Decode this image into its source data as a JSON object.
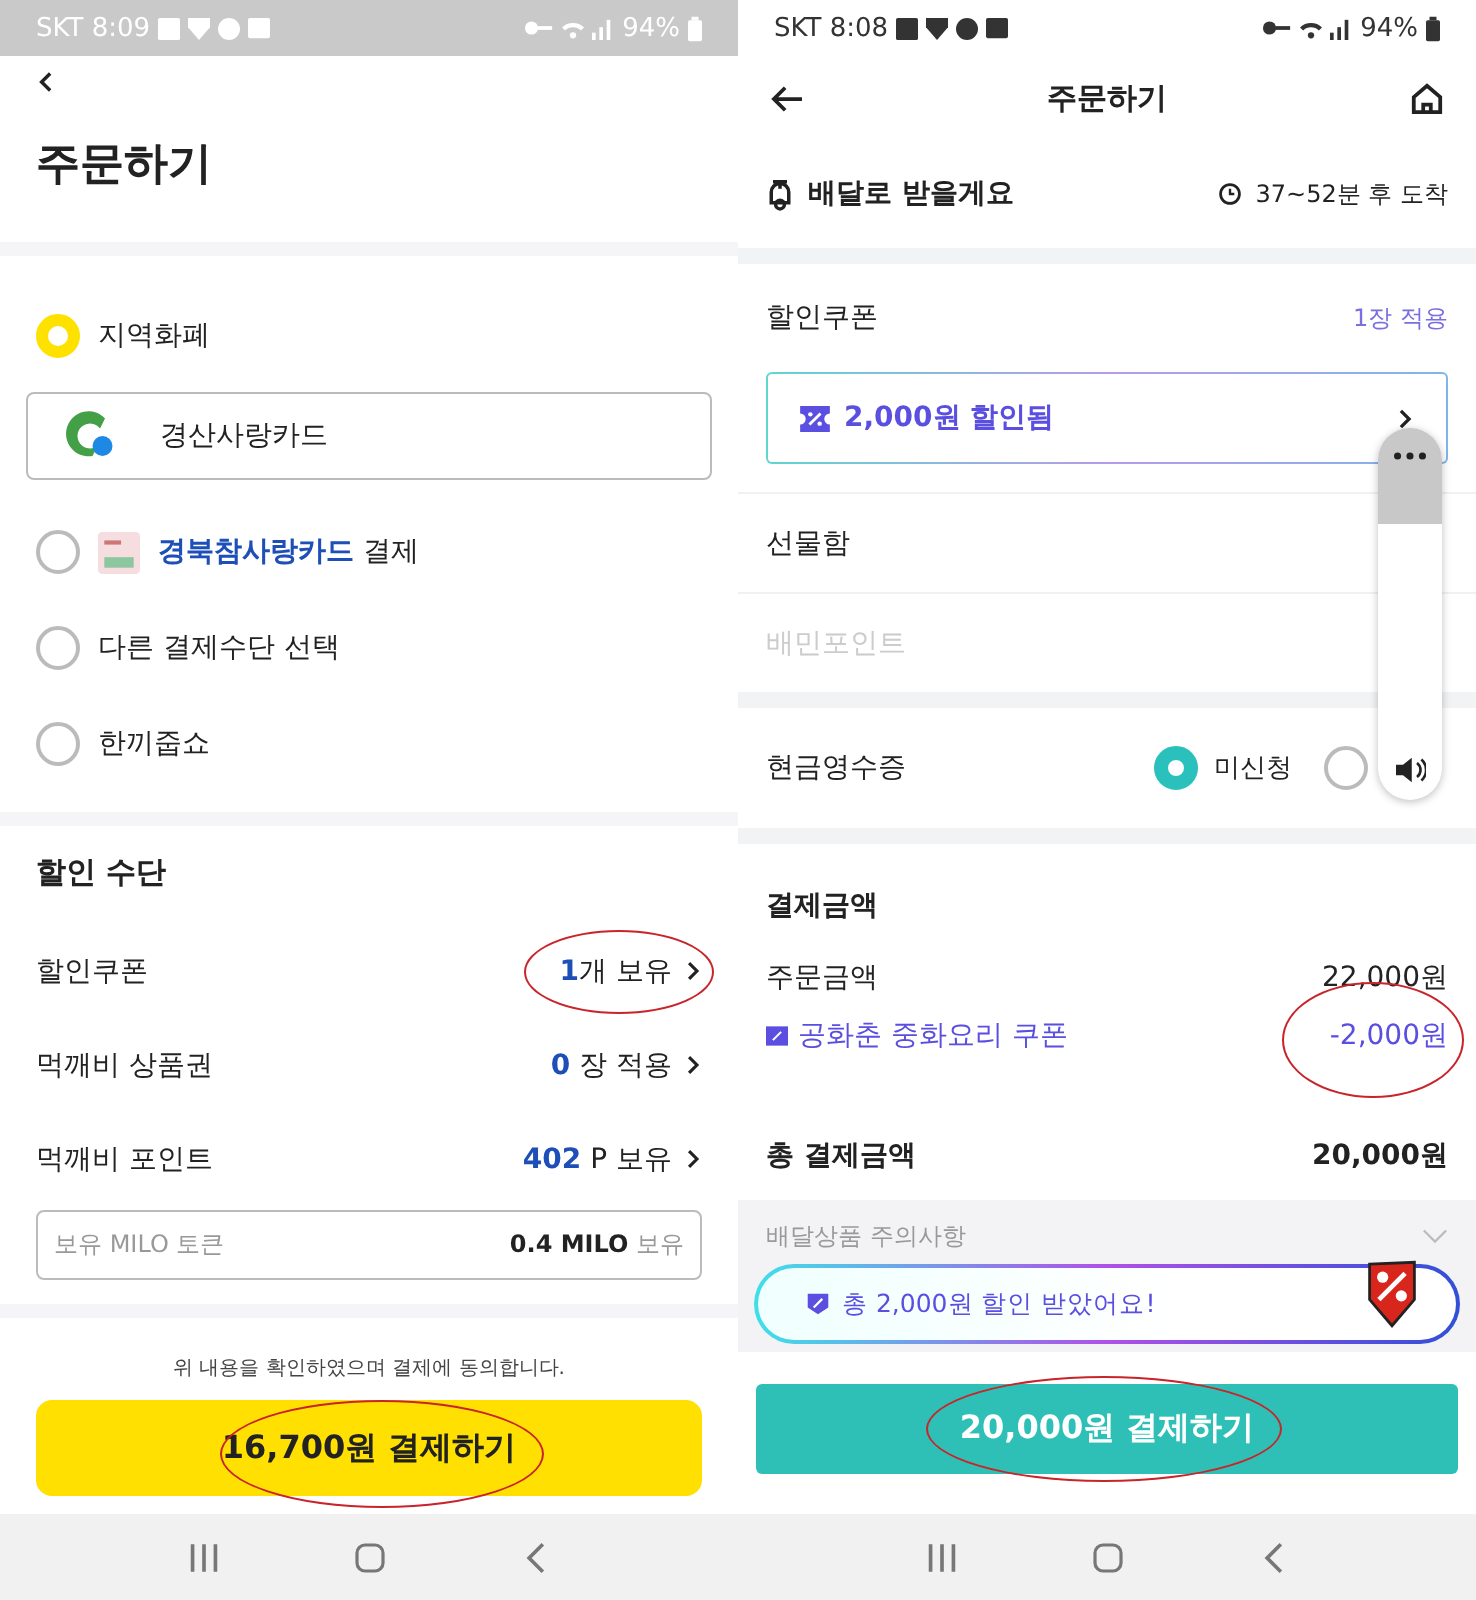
{
  "left_screen": {
    "status_bar": {
      "carrier_time": "SKT 8:09",
      "battery": "94%"
    },
    "title": "주문하기",
    "payment_options": [
      {
        "kind": "plain",
        "label": "지역화폐",
        "selected": true,
        "card": "경산사랑카드"
      },
      {
        "kind": "logo",
        "highlight": "경북참사랑카드",
        "label": "결제",
        "selected": false
      },
      {
        "kind": "plain",
        "label": "다른 결제수단 선택",
        "selected": false
      },
      {
        "kind": "plain",
        "label": "한끼줍쇼",
        "selected": false
      }
    ],
    "discount_section": {
      "title": "할인 수단",
      "rows": [
        {
          "label": "할인쿠폰",
          "count": "1",
          "unit": "개 보유",
          "circled": true
        },
        {
          "label": "먹깨비 상품권",
          "count": "0",
          "unit": " 장 적용",
          "circled": false
        },
        {
          "label": "먹깨비 포인트",
          "count": "402",
          "unit": " P 보유",
          "circled": false
        }
      ],
      "token_field": {
        "placeholder": "보유 MILO 토큰",
        "value": "0.4 MILO",
        "suffix": "보유"
      }
    },
    "agreement": "위 내용을 확인하였으며 결제에 동의합니다.",
    "pay_button": {
      "label": "16,700원 결제하기",
      "circled": true
    }
  },
  "right_screen": {
    "status_bar": {
      "carrier_time": "SKT 8:08",
      "battery": "94%"
    },
    "title": "주문하기",
    "delivery": {
      "label": "배달로 받을게요",
      "eta": "37~52분 후 도착"
    },
    "coupon": {
      "label": "할인쿠폰",
      "applied": "1장 적용",
      "banner": "2,000원 할인됨"
    },
    "rows": [
      {
        "label": "선물함",
        "disabled": false
      },
      {
        "label": "배민포인트",
        "disabled": true
      }
    ],
    "cash_receipt": {
      "label": "현금영수증",
      "options": [
        {
          "label": "미신청",
          "selected": true
        },
        {
          "selected": false
        }
      ]
    },
    "payment": {
      "title": "결제금액",
      "lines": [
        {
          "kind": "plain",
          "label": "주문금액",
          "amount": "22,000원",
          "circled": false
        },
        {
          "kind": "coupon",
          "label": "공화춘 중화요리 쿠폰",
          "amount": "-2,000원",
          "circled": true
        }
      ],
      "total_label": "총 결제금액",
      "total": "20,000원"
    },
    "notice": "배달상품 주의사항",
    "toast": "총 2,000원 할인 받았어요!",
    "pay_button": {
      "label": "20,000원 결제하기",
      "circled": true
    }
  }
}
